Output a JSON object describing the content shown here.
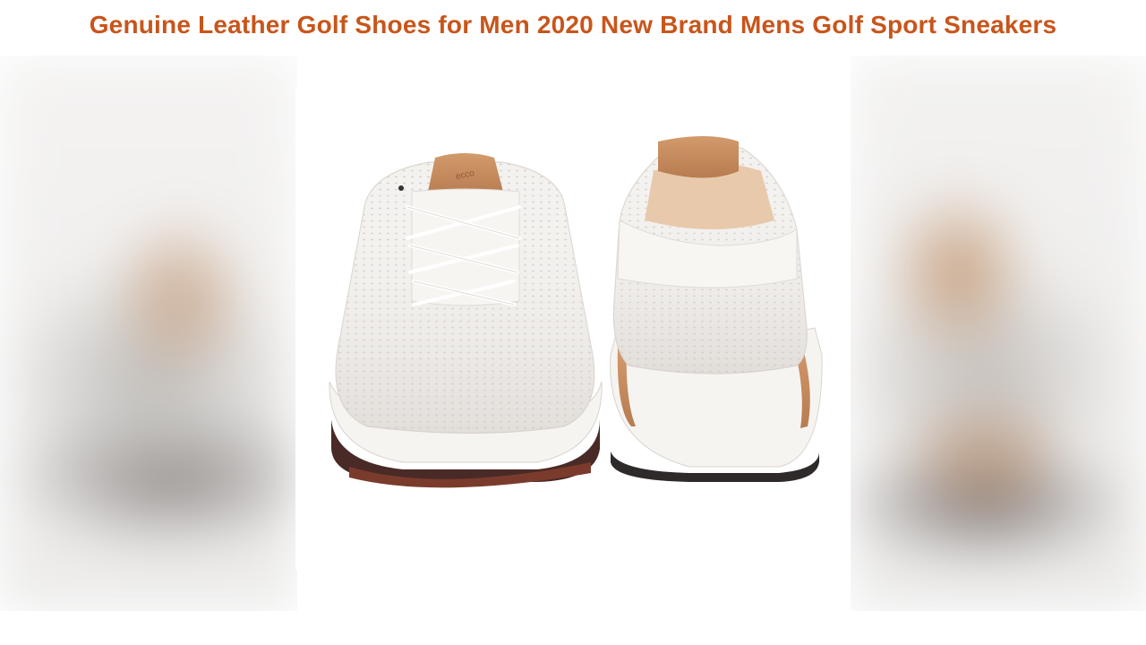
{
  "video": {
    "title": "Genuine Leather Golf Shoes for Men 2020 New Brand Mens Golf Sport Sneakers"
  },
  "product_image": {
    "brand_logo_text": "ecco",
    "colors": {
      "title": "#c8551b",
      "upper": "#f4f2ef",
      "accent_leather": "#c58c5e",
      "sole_dark": "#4a2a26"
    }
  }
}
